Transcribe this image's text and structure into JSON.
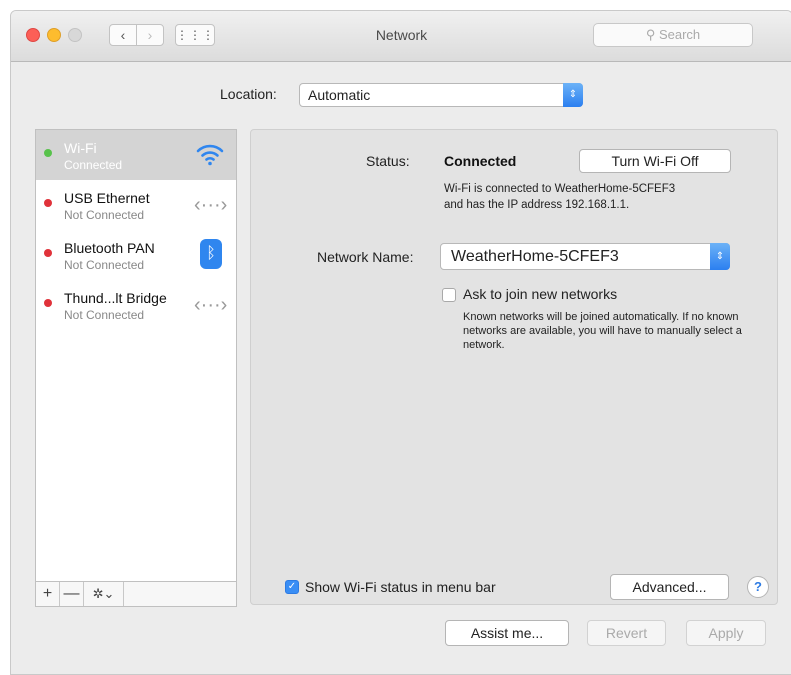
{
  "window": {
    "title": "Network",
    "search_placeholder": "Search",
    "nav_back": "‹",
    "nav_forward": "›",
    "grid_icon": "⋮⋮⋮"
  },
  "location": {
    "label": "Location:",
    "value": "Automatic"
  },
  "sidebar": {
    "services": [
      {
        "name": "Wi-Fi",
        "status": "Connected",
        "dot_color": "#58c24b",
        "icon": "wifi-icon",
        "selected": true
      },
      {
        "name": "USB Ethernet",
        "status": "Not Connected",
        "dot_color": "#e0323a",
        "icon": "ethernet-icon"
      },
      {
        "name": "Bluetooth PAN",
        "status": "Not Connected",
        "dot_color": "#e0323a",
        "icon": "bluetooth-icon"
      },
      {
        "name": "Thund...lt Bridge",
        "status": "Not Connected",
        "dot_color": "#e0323a",
        "icon": "ethernet-icon"
      }
    ],
    "add_label": "+",
    "remove_label": "—",
    "action_label": "✲⌄"
  },
  "detail": {
    "status_label": "Status:",
    "status_value": "Connected",
    "turn_off_button": "Turn Wi-Fi Off",
    "status_desc_line1": "Wi-Fi is connected to WeatherHome-5CFEF3",
    "status_desc_line2": "and has the IP address 192.168.1.1.",
    "network_name_label": "Network Name:",
    "network_name_value": "WeatherHome-5CFEF3",
    "ask_join_label": "Ask to join new networks",
    "ask_join_checked": false,
    "ask_join_desc": "Known networks will be joined automatically. If no known networks are available, you will have to manually select a network.",
    "show_status_label": "Show Wi-Fi status in menu bar",
    "show_status_checked": true,
    "advanced_button": "Advanced...",
    "help_button": "?"
  },
  "footer": {
    "assist_button": "Assist me...",
    "revert_button": "Revert",
    "apply_button": "Apply"
  },
  "colors": {
    "accent": "#2f86ef",
    "connected": "#58c24b",
    "disconnected": "#e0323a"
  }
}
